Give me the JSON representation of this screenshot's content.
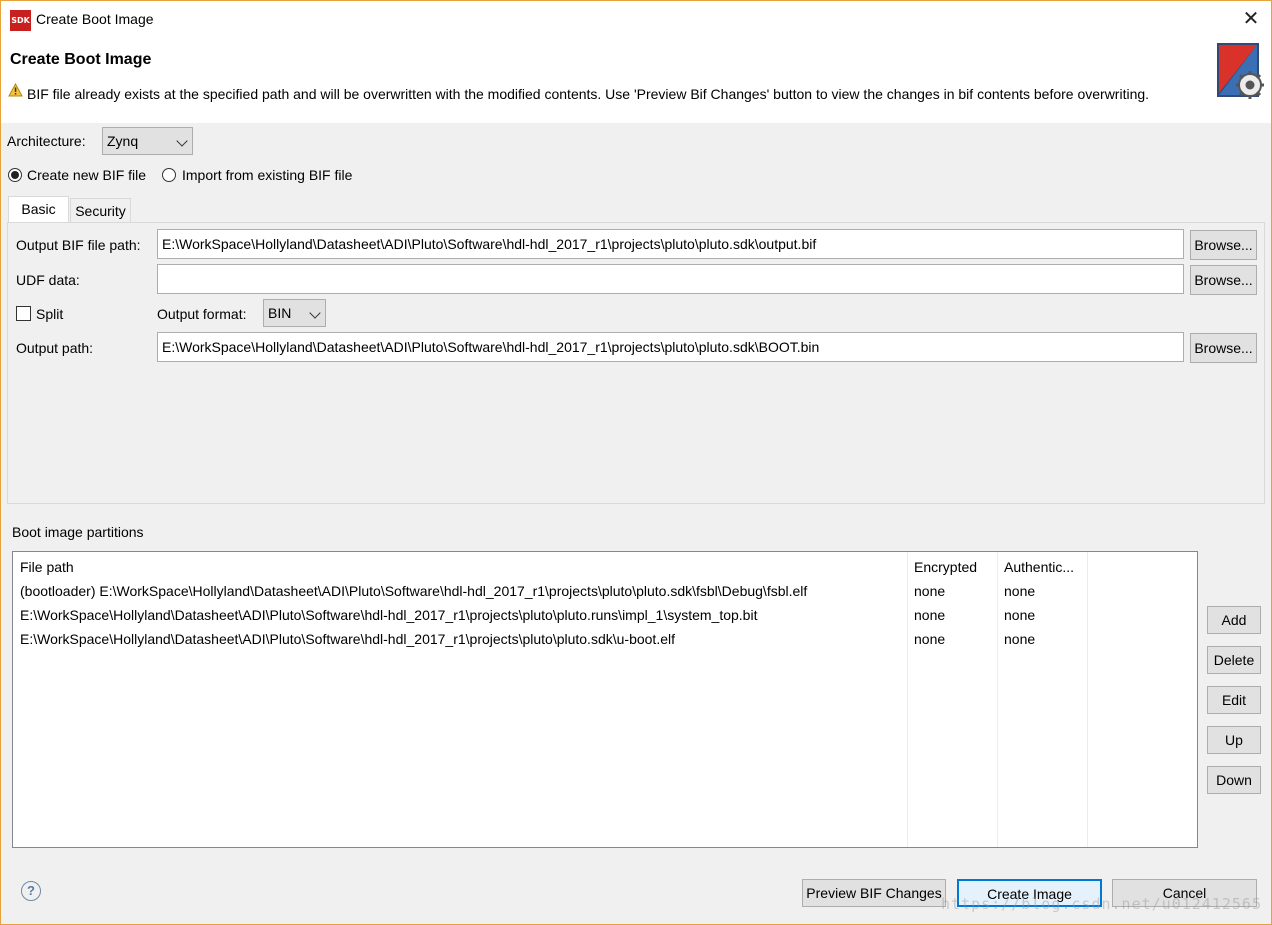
{
  "window": {
    "app_icon_text": "SDK",
    "title": "Create Boot Image",
    "close_glyph": "✕",
    "accent_border_color": "#e8a23c"
  },
  "header": {
    "title": "Create Boot Image",
    "warning": "BIF file already exists at the specified path and will be overwritten with the modified contents. Use 'Preview Bif Changes' button to view the changes in bif contents before overwriting."
  },
  "architecture": {
    "label": "Architecture:",
    "value": "Zynq"
  },
  "bif_mode": {
    "create_new_label": "Create new BIF file",
    "create_new_selected": true,
    "import_label": "Import from existing BIF file",
    "import_selected": false
  },
  "tabs": [
    {
      "label": "Basic",
      "active": true
    },
    {
      "label": "Security",
      "active": false
    }
  ],
  "basic": {
    "output_bif_label": "Output BIF file path:",
    "output_bif_value": "E:\\WorkSpace\\Hollyland\\Datasheet\\ADI\\Pluto\\Software\\hdl-hdl_2017_r1\\projects\\pluto\\pluto.sdk\\output.bif",
    "udf_label": "UDF data:",
    "udf_value": "",
    "split_label": "Split",
    "split_checked": false,
    "output_format_label": "Output format:",
    "output_format_value": "BIN",
    "output_path_label": "Output path:",
    "output_path_value": "E:\\WorkSpace\\Hollyland\\Datasheet\\ADI\\Pluto\\Software\\hdl-hdl_2017_r1\\projects\\pluto\\pluto.sdk\\BOOT.bin",
    "browse_label": "Browse..."
  },
  "partitions": {
    "section_label": "Boot image partitions",
    "columns": [
      "File path",
      "Encrypted",
      "Authentic..."
    ],
    "rows": [
      [
        "(bootloader) E:\\WorkSpace\\Hollyland\\Datasheet\\ADI\\Pluto\\Software\\hdl-hdl_2017_r1\\projects\\pluto\\pluto.sdk\\fsbl\\Debug\\fsbl.elf",
        "none",
        "none"
      ],
      [
        "E:\\WorkSpace\\Hollyland\\Datasheet\\ADI\\Pluto\\Software\\hdl-hdl_2017_r1\\projects\\pluto\\pluto.runs\\impl_1\\system_top.bit",
        "none",
        "none"
      ],
      [
        "E:\\WorkSpace\\Hollyland\\Datasheet\\ADI\\Pluto\\Software\\hdl-hdl_2017_r1\\projects\\pluto\\pluto.sdk\\u-boot.elf",
        "none",
        "none"
      ]
    ],
    "buttons": {
      "add": "Add",
      "delete": "Delete",
      "edit": "Edit",
      "up": "Up",
      "down": "Down"
    }
  },
  "footer": {
    "help_glyph": "?",
    "preview_label": "Preview BIF Changes",
    "create_label": "Create Image",
    "cancel_label": "Cancel"
  },
  "watermark": "https://blog.csdn.net/u012412565"
}
